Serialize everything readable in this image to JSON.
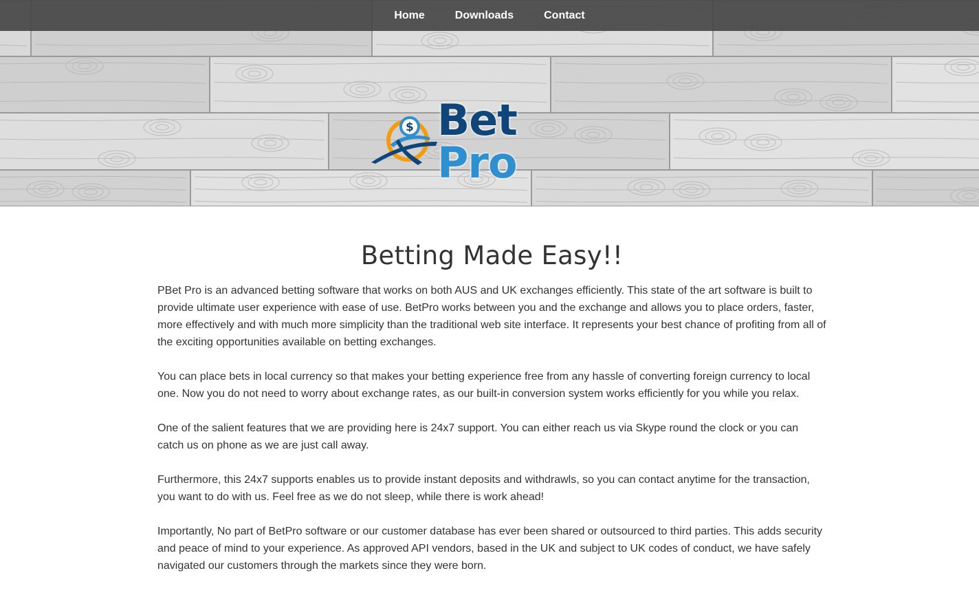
{
  "nav": {
    "items": [
      {
        "label": "Home"
      },
      {
        "label": "Downloads"
      },
      {
        "label": "Contact"
      }
    ]
  },
  "logo": {
    "word1": "Bet",
    "word2": "Pro",
    "colors": {
      "dark_blue": "#0f4578",
      "light_blue": "#2f8fcf",
      "orange": "#f39c12"
    }
  },
  "main": {
    "title": "Betting Made Easy!!",
    "paragraphs": [
      "PBet Pro is an advanced betting software that works on both AUS and UK exchanges efficiently. This state of the art software is built to provide ultimate user experience with ease of use. BetPro works between you and the exchange and allows you to place orders, faster, more effectively and with much more simplicity than the traditional web site interface. It represents your best chance of profiting from all of the exciting opportunities available on betting exchanges.",
      "You can place bets in local currency so that makes your betting experience free from any hassle of converting foreign currency to local one. Now you do not need to worry about exchange rates, as our built-in conversion system works efficiently for you while you relax.",
      "One of the salient features that we are providing here is 24x7 support. You can either reach us via Skype round the clock or you can catch us on phone as we are just call away.",
      "Furthermore, this 24x7 supports enables us to provide instant deposits and withdrawls, so you can contact anytime for the transaction, you want to do with us. Feel free as we do not sleep, while there is work ahead!",
      "Importantly, No part of BetPro software or our customer database has ever been shared or outsourced to third parties. This adds security and peace of mind to your experience. As approved API vendors, based in the UK and subject to UK codes of conduct, we have safely navigated our customers through the markets since they were born."
    ]
  }
}
